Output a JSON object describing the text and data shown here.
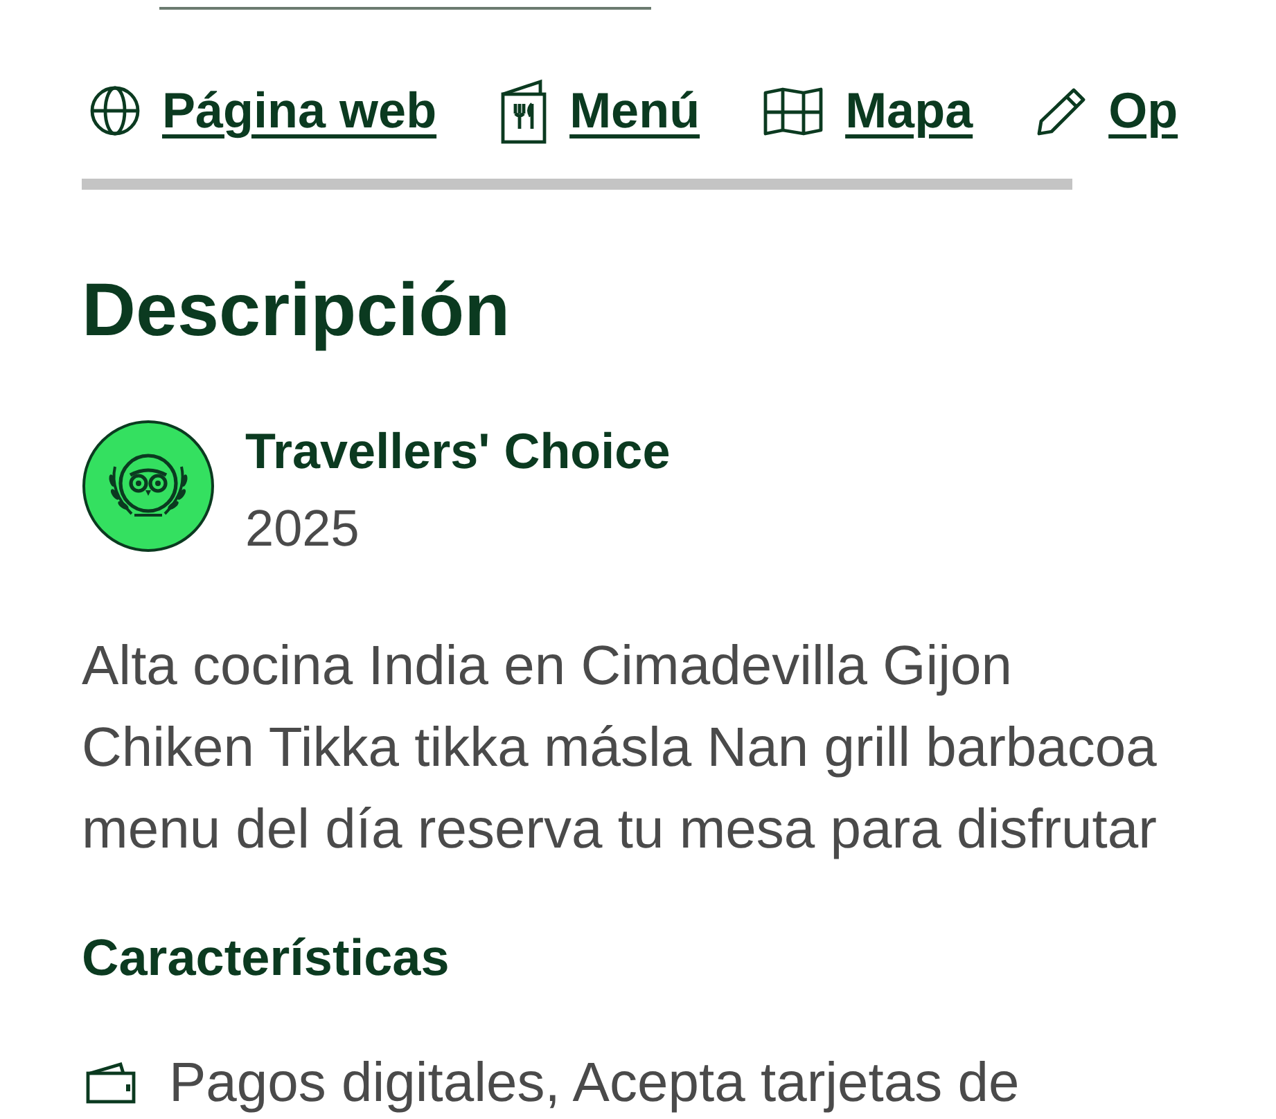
{
  "links": [
    {
      "kind": "globe",
      "label": "Página web"
    },
    {
      "kind": "menu",
      "label": "Menú"
    },
    {
      "kind": "map",
      "label": "Mapa"
    },
    {
      "kind": "pencil",
      "label": "Op"
    }
  ],
  "description": {
    "title": "Descripción",
    "award": {
      "name": "Travellers' Choice",
      "year": "2025"
    },
    "text": "Alta cocina India en Cimadevilla Gijon\nChiken Tikka tikka másla Nan grill barbacoa\nmenu del día reserva tu mesa para disfrutar"
  },
  "features": {
    "title": "Características",
    "items": [
      {
        "kind": "wallet",
        "text": "Pagos digitales, Acepta tarjetas de"
      }
    ]
  }
}
